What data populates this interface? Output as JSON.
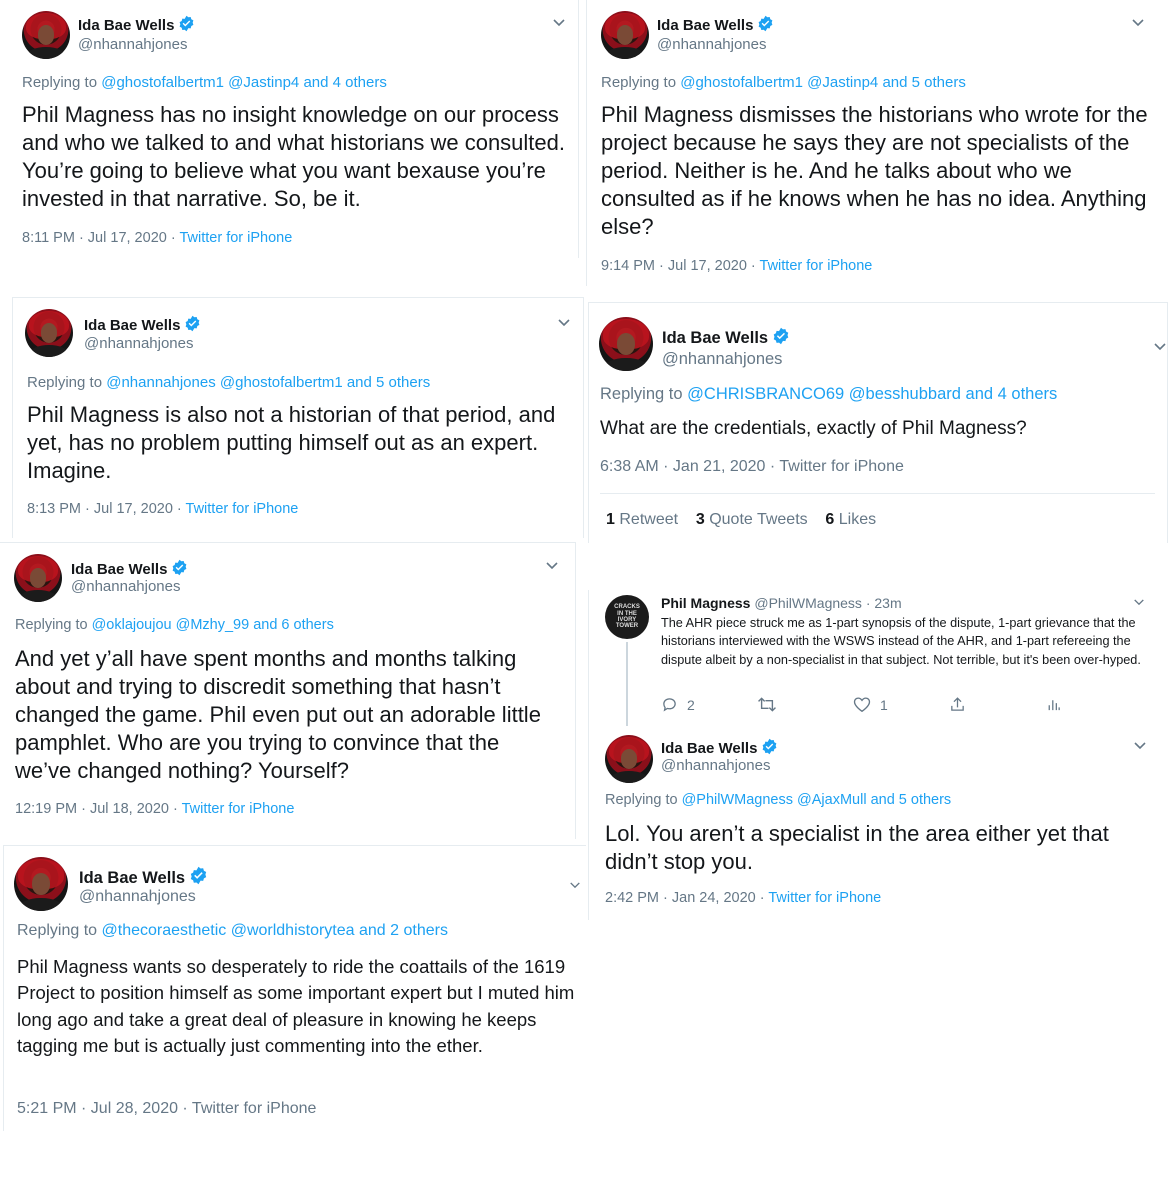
{
  "brand": {
    "accent": "#1da1f2",
    "muted": "#657786",
    "text": "#14171a",
    "line": "#ccd6dd"
  },
  "icons": {
    "verified": "verified-badge-icon",
    "caret": "chevron-down-icon"
  },
  "tweets": [
    {
      "name": "Ida Bae Wells",
      "handle": "@nhannahjones",
      "reply_prefix": "Replying to",
      "reply_mentions": "@ghostofalbertm1 @Jastinp4 and 4 others",
      "text": "Phil Magness has no insight knowledge on our process and who we talked to and what historians we consulted. You’re going to believe what you want bexause you’re invested in that narrative. So, be it.",
      "time": "8:11 PM · Jul 17, 2020 ·",
      "source": "Twitter for iPhone"
    },
    {
      "name": "Ida Bae Wells",
      "handle": "@nhannahjones",
      "reply_prefix": "Replying to",
      "reply_mentions": "@ghostofalbertm1 @Jastinp4 and 5 others",
      "text": "Phil Magness dismisses the historians who wrote for the project because he says they are not specialists of the period. Neither is he. And he talks about who we consulted as if he knows when he has no idea. Anything else?",
      "time": "9:14 PM · Jul 17, 2020 ·",
      "source": "Twitter for iPhone"
    },
    {
      "name": "Ida Bae Wells",
      "handle": "@nhannahjones",
      "reply_prefix": "Replying to",
      "reply_mentions": "@nhannahjones @ghostofalbertm1 and 5 others",
      "text": "Phil Magness is also not a historian of that period, and yet, has no problem putting himself out as an expert. Imagine.",
      "time": "8:13 PM · Jul 17, 2020 ·",
      "source": "Twitter for iPhone"
    },
    {
      "name": "Ida Bae Wells",
      "handle": "@nhannahjones",
      "reply_prefix": "Replying to",
      "reply_mentions": "@CHRISBRANCO69 @besshubbard and 4 others",
      "text": "What are the credentials, exactly of Phil Magness?",
      "time": "6:38 AM · Jan 21, 2020 · Twitter for iPhone",
      "stats": {
        "retweets": "1",
        "retweets_label": "Retweet",
        "quotes": "3",
        "quotes_label": "Quote Tweets",
        "likes": "6",
        "likes_label": "Likes"
      }
    },
    {
      "name": "Ida Bae Wells",
      "handle": "@nhannahjones",
      "reply_prefix": "Replying to",
      "reply_mentions": "@oklajoujou @Mzhy_99 and 6 others",
      "text": "And yet y’all have spent months and months talking about and trying to discredit something that hasn’t changed the game. Phil even put out an adorable little pamphlet. Who are you trying to convince that the we’ve changed nothing? Yourself?",
      "time": "12:19 PM · Jul 18, 2020 ·",
      "source": "Twitter for iPhone"
    },
    {
      "name": "Phil Magness",
      "handle": "@PhilWMagness · 23m",
      "avatar_text": "CRACKS IN THE IVORY TOWER",
      "text": "The AHR piece struck me as 1-part synopsis of the dispute, 1-part grievance that the historians interviewed with the WSWS instead of the AHR, and 1-part refereeing the dispute albeit by a non-specialist in that subject. Not terrible, but it's been over-hyped.",
      "replies": "2",
      "likes": "1"
    },
    {
      "name": "Ida Bae Wells",
      "handle": "@nhannahjones",
      "reply_prefix": "Replying to",
      "reply_mentions": "@PhilWMagness @AjaxMull and 5 others",
      "text": "Lol. You aren’t a specialist in the area either yet that didn’t stop you.",
      "time": "2:42 PM · Jan 24, 2020 ·",
      "source": "Twitter for iPhone"
    },
    {
      "name": "Ida Bae Wells",
      "handle": "@nhannahjones",
      "reply_prefix": "Replying to",
      "reply_mentions": "@thecoraesthetic @worldhistorytea and 2 others",
      "text": "Phil Magness wants so desperately to ride the coattails of the 1619 Project to position himself as some important expert but I muted him long ago and take a great deal of pleasure in knowing he keeps tagging me but is actually just commenting into the ether.",
      "time": "5:21 PM · Jul 28, 2020 ·",
      "source": "Twitter for iPhone"
    }
  ]
}
